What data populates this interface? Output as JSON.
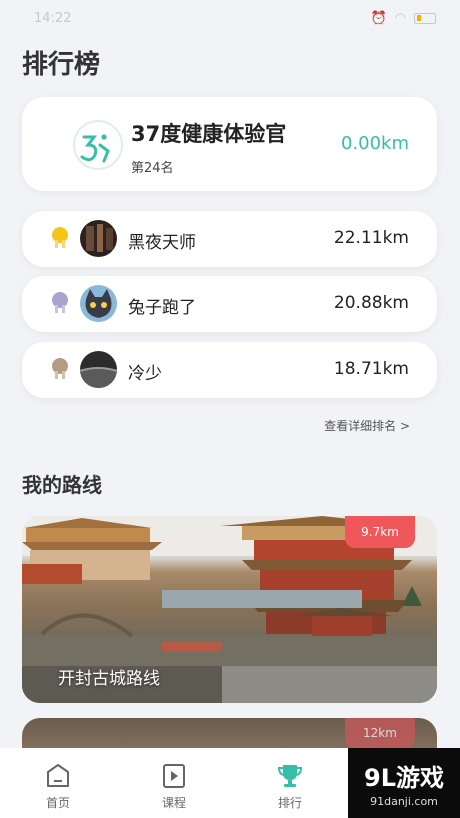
{
  "status_bar": {
    "time": "14:22"
  },
  "page_title": "排行榜",
  "my_rank": {
    "name": "37度健康体验官",
    "rank": "第24名",
    "distance": "0.00km",
    "accent_color": "#36bfa6"
  },
  "leaderboard": [
    {
      "name": "黑夜天师",
      "distance": "22.11km",
      "medal": "gold-medal-icon",
      "medal_color": "#f5c518"
    },
    {
      "name": "兔子跑了",
      "distance": "20.88km",
      "medal": "silver-medal-icon",
      "medal_color": "#a9a3cf"
    },
    {
      "name": "冷少",
      "distance": "18.71km",
      "medal": "bronze-medal-icon",
      "medal_color": "#b39d82"
    }
  ],
  "detail_link": "查看详细排名 >",
  "routes_title": "我的路线",
  "routes": [
    {
      "name": "开封古城路线",
      "distance": "9.7km",
      "badge_color": "#f0575a"
    },
    {
      "name": "",
      "distance": "12km",
      "badge_color": "#c0595a"
    }
  ],
  "tab_bar": {
    "tabs": [
      {
        "label": "首页",
        "icon": "home-icon"
      },
      {
        "label": "课程",
        "icon": "play-icon"
      },
      {
        "label": "排行",
        "icon": "trophy-icon",
        "active_color": "#36bfa6"
      }
    ]
  },
  "watermark": {
    "main": "9L游戏",
    "sub": "91danji.com"
  }
}
